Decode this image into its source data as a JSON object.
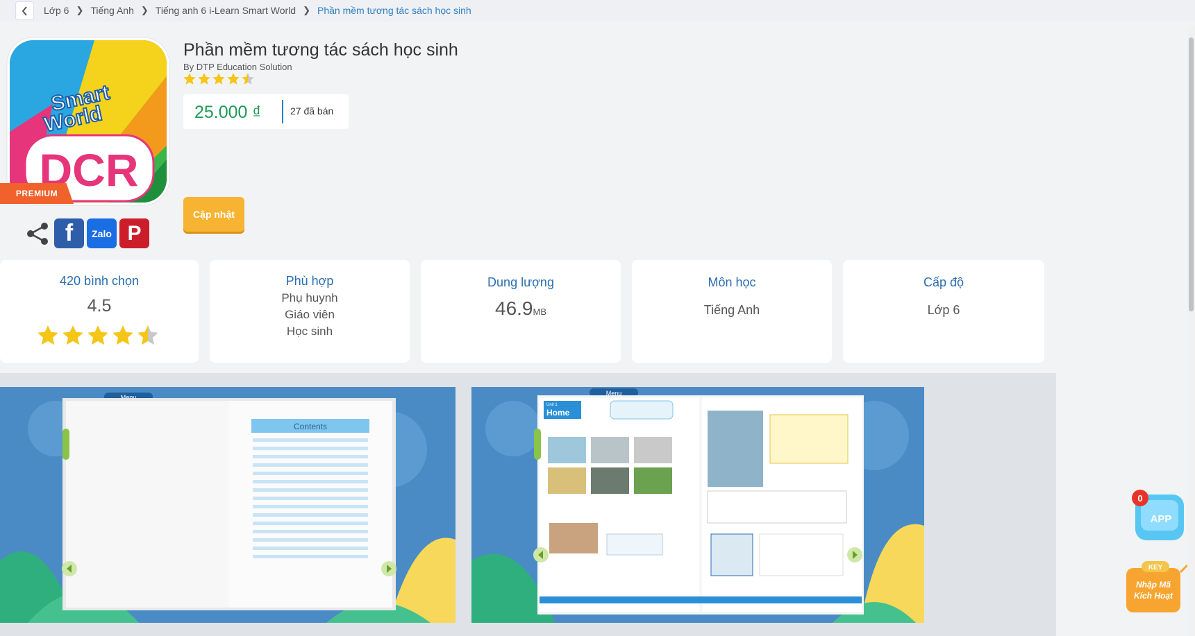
{
  "breadcrumb": {
    "items": [
      "Lớp 6",
      "Tiếng Anh",
      "Tiếng anh 6 i-Learn Smart World",
      "Phần mềm tương tác sách học sinh"
    ]
  },
  "product": {
    "title": "Phần mềm tương tác sách học sinh",
    "publisher": "By DTP Education Solution",
    "rating_stars": 4.5,
    "price": "25.000 ₫",
    "sold": "27 đã bán",
    "update_button": "Cập nhật",
    "badge": "PREMIUM",
    "icon_logo_text": "i-Learn Smart World",
    "icon_text": "DCR"
  },
  "share": {
    "zalo_label": "Zalo"
  },
  "stats": {
    "votes": {
      "label": "420 bình chọn",
      "value": "4.5",
      "stars": 4.5
    },
    "suitable": {
      "label": "Phù hợp",
      "items": [
        "Phụ huynh",
        "Giáo viên",
        "Học sinh"
      ]
    },
    "size": {
      "label": "Dung lượng",
      "value": "46.9",
      "unit": "MB"
    },
    "subject": {
      "label": "Môn học",
      "value": "Tiếng Anh"
    },
    "level": {
      "label": "Cấp độ",
      "value": "Lớp 6"
    }
  },
  "gallery": {
    "menu_label": "Menu",
    "contents_title": "Contents",
    "unit_title": "Home",
    "unit_tab": "Unit 1"
  },
  "floating": {
    "app_count": "0",
    "app_label": "APP",
    "key_label": "KEY",
    "key_text_1": "Nhập Mã",
    "key_text_2": "Kích Hoạt"
  },
  "colors": {
    "accent_blue": "#2a6db0",
    "price_green": "#1e9a55",
    "update_orange": "#f7b332",
    "premium_orange": "#f1612c"
  }
}
